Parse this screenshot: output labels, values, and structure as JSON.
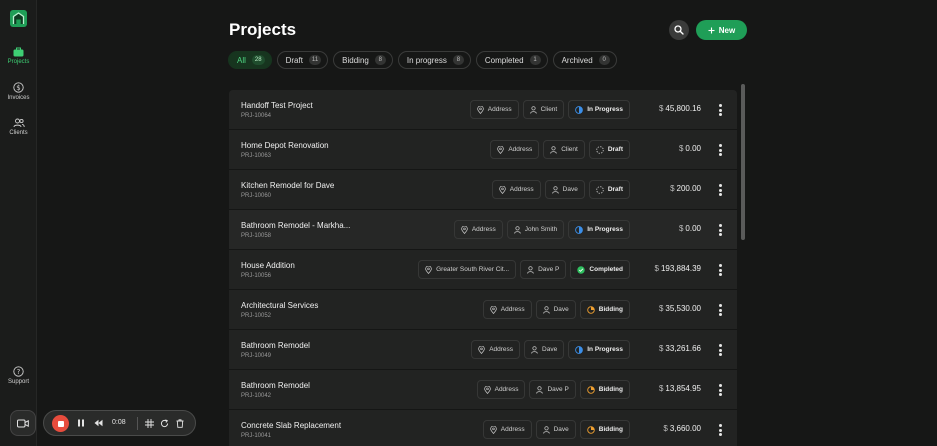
{
  "sidebar": {
    "logo_icon": "house-logo-icon",
    "items": [
      {
        "label": "Projects",
        "icon": "briefcase-icon",
        "active": true
      },
      {
        "label": "Invoices",
        "icon": "dollar-circle-icon",
        "active": false
      },
      {
        "label": "Clients",
        "icon": "users-icon",
        "active": false
      }
    ],
    "support": {
      "label": "Support",
      "icon": "help-circle-icon"
    }
  },
  "header": {
    "title": "Projects",
    "new_label": "New"
  },
  "filters": [
    {
      "label": "All",
      "count": "28",
      "active": true
    },
    {
      "label": "Draft",
      "count": "11",
      "active": false
    },
    {
      "label": "Bidding",
      "count": "8",
      "active": false
    },
    {
      "label": "In progress",
      "count": "8",
      "active": false
    },
    {
      "label": "Completed",
      "count": "1",
      "active": false
    },
    {
      "label": "Archived",
      "count": "0",
      "active": false
    }
  ],
  "projects": [
    {
      "name": "Handoff Test Project",
      "code": "PRJ-10064",
      "address": "Address",
      "client": "Client",
      "status": "In Progress",
      "status_kind": "progress",
      "amount": "45,800.16"
    },
    {
      "name": "Home Depot Renovation",
      "code": "PRJ-10063",
      "address": "Address",
      "client": "Client",
      "status": "Draft",
      "status_kind": "draft",
      "amount": "0.00"
    },
    {
      "name": "Kitchen Remodel for Dave",
      "code": "PRJ-10060",
      "address": "Address",
      "client": "Dave",
      "status": "Draft",
      "status_kind": "draft",
      "amount": "200.00"
    },
    {
      "name": "Bathroom Remodel - Markha...",
      "code": "PRJ-10058",
      "address": "Address",
      "client": "John Smith",
      "status": "In Progress",
      "status_kind": "progress",
      "amount": "0.00"
    },
    {
      "name": "House Addition",
      "code": "PRJ-10056",
      "address": "Greater South River Cit...",
      "client": "Dave P",
      "status": "Completed",
      "status_kind": "completed",
      "amount": "193,884.39"
    },
    {
      "name": "Architectural Services",
      "code": "PRJ-10052",
      "address": "Address",
      "client": "Dave",
      "status": "Bidding",
      "status_kind": "bidding",
      "amount": "35,530.00"
    },
    {
      "name": "Bathroom Remodel",
      "code": "PRJ-10049",
      "address": "Address",
      "client": "Dave",
      "status": "In Progress",
      "status_kind": "progress",
      "amount": "33,261.66"
    },
    {
      "name": "Bathroom Remodel",
      "code": "PRJ-10042",
      "address": "Address",
      "client": "Dave P",
      "status": "Bidding",
      "status_kind": "bidding",
      "amount": "13,854.95"
    },
    {
      "name": "Concrete Slab Replacement",
      "code": "PRJ-10041",
      "address": "Address",
      "client": "Dave",
      "status": "Bidding",
      "status_kind": "bidding",
      "amount": "3,660.00"
    }
  ],
  "currency_symbol": "$",
  "colors": {
    "accent_green": "#1f9e57",
    "active_green": "#3ecf74",
    "in_progress": "#3b8ee8",
    "bidding": "#f0a030",
    "completed": "#2fbf5f",
    "draft": "#bbbbbb"
  },
  "recorder": {
    "time": "0:08",
    "icons": [
      "video-camera-icon",
      "stop-icon",
      "pause-icon",
      "rewind-icon",
      "grid-icon",
      "restart-icon",
      "trash-icon"
    ]
  }
}
